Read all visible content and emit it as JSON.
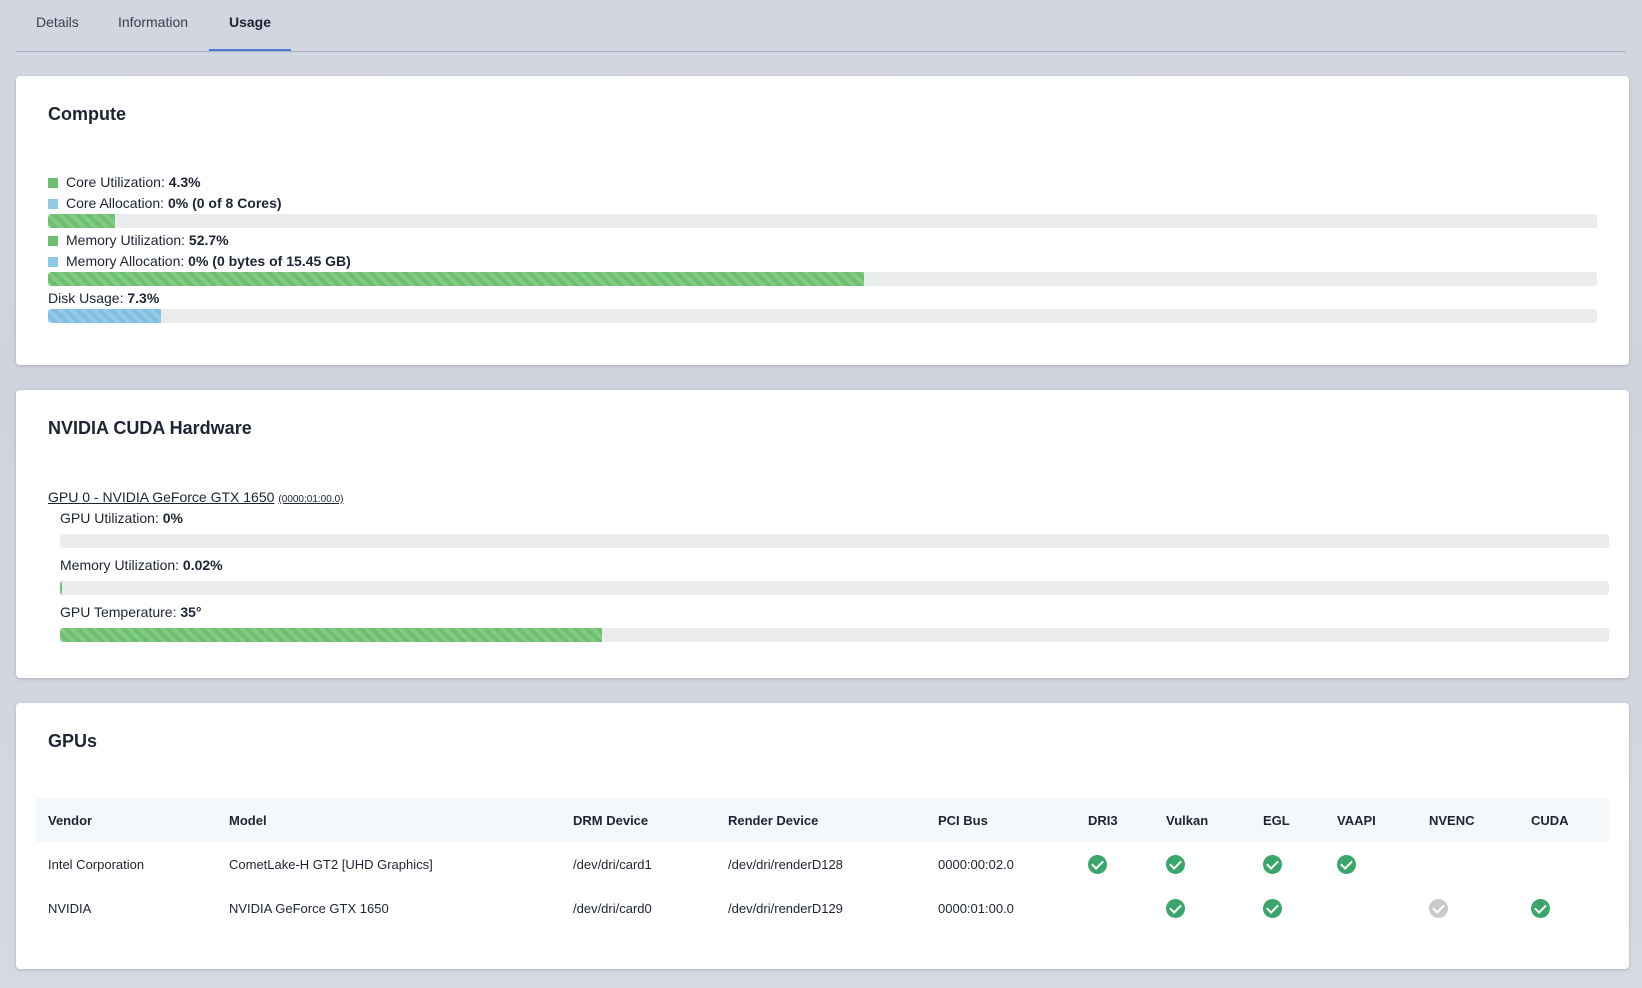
{
  "tabs": [
    {
      "label": "Details"
    },
    {
      "label": "Information"
    },
    {
      "label": "Usage",
      "active": true
    }
  ],
  "compute": {
    "title": "Compute",
    "core_utilization": {
      "label": "Core Utilization:",
      "value": "4.3%"
    },
    "core_allocation": {
      "label": "Core Allocation:",
      "value": "0% (0 of 8 Cores)"
    },
    "core_bar_fraction": 0.043,
    "memory_utilization": {
      "label": "Memory Utilization:",
      "value": "52.7%"
    },
    "memory_allocation": {
      "label": "Memory Allocation:",
      "value": "0% (0 bytes of 15.45 GB)"
    },
    "memory_bar_fraction": 0.527,
    "disk_usage": {
      "label": "Disk Usage:",
      "value": "7.3%"
    },
    "disk_bar_fraction": 0.073
  },
  "cuda": {
    "title": "NVIDIA CUDA Hardware",
    "gpu_name": "GPU 0 - NVIDIA GeForce GTX 1650",
    "gpu_bus": "(0000:01:00.0)",
    "gpu_utilization": {
      "label": "GPU Utilization:",
      "value": "0%"
    },
    "gpu_bar_fraction": 0.0,
    "memory_utilization": {
      "label": "Memory Utilization:",
      "value": "0.02%"
    },
    "memory_bar_fraction": 0.0002,
    "gpu_temperature": {
      "label": "GPU Temperature:",
      "value": "35°"
    },
    "temperature_bar_fraction": 0.35
  },
  "gpus": {
    "title": "GPUs",
    "columns": [
      "Vendor",
      "Model",
      "DRM Device",
      "Render Device",
      "PCI Bus",
      "DRI3",
      "Vulkan",
      "EGL",
      "VAAPI",
      "NVENC",
      "CUDA"
    ],
    "rows": [
      {
        "vendor": "Intel Corporation",
        "model": "CometLake-H GT2 [UHD Graphics]",
        "drm_device": "/dev/dri/card1",
        "render_device": "/dev/dri/renderD128",
        "pci_bus": "0000:00:02.0",
        "dri3": "enabled",
        "vulkan": "enabled",
        "egl": "enabled",
        "vaapi": "enabled",
        "nvenc": "none",
        "cuda": "none"
      },
      {
        "vendor": "NVIDIA",
        "model": "NVIDIA GeForce GTX 1650",
        "drm_device": "/dev/dri/card0",
        "render_device": "/dev/dri/renderD129",
        "pci_bus": "0000:01:00.0",
        "dri3": "none",
        "vulkan": "enabled",
        "egl": "enabled",
        "vaapi": "none",
        "nvenc": "disabled",
        "cuda": "enabled"
      }
    ]
  },
  "colors": {
    "accent": "#4a7bd6",
    "utilization_green": "#6cc070",
    "allocation_blue": "#8ecae6",
    "check_enabled": "#3aa66a",
    "check_disabled": "#c9cacc"
  }
}
